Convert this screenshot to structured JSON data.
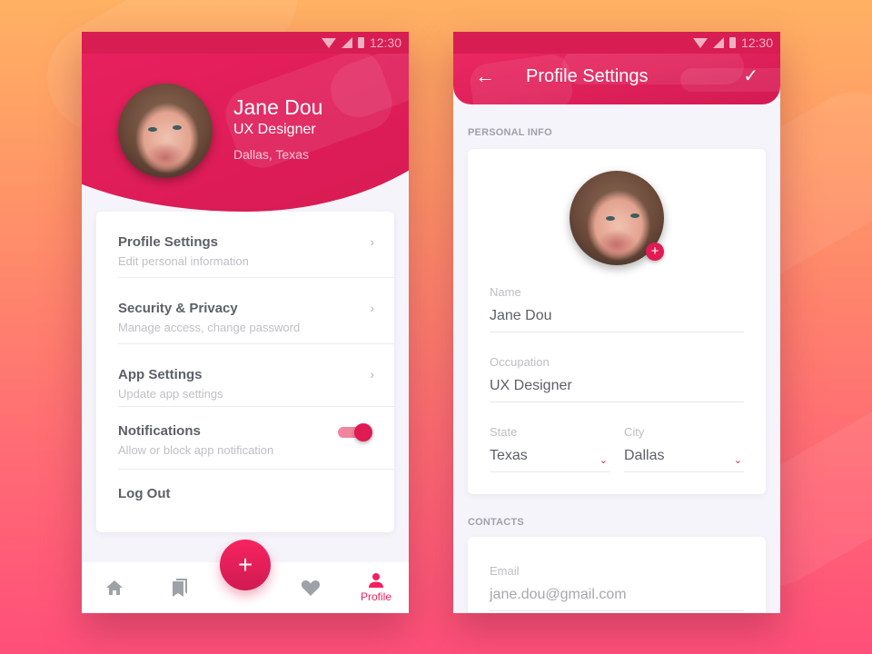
{
  "status_bar": {
    "time": "12:30"
  },
  "profile_screen": {
    "user": {
      "name": "Jane Dou",
      "role": "UX Designer",
      "location": "Dallas, Texas"
    },
    "menu": [
      {
        "title": "Profile Settings",
        "subtitle": "Edit personal information",
        "trailing": "chevron"
      },
      {
        "title": "Security & Privacy",
        "subtitle": "Manage access, change password",
        "trailing": "chevron"
      },
      {
        "title": "App Settings",
        "subtitle": "Update app settings",
        "trailing": "chevron"
      },
      {
        "title": "Notifications",
        "subtitle": "Allow or block app notification",
        "trailing": "toggle",
        "enabled": true
      },
      {
        "title": "Log Out"
      }
    ],
    "fab_label": "+",
    "bottom_nav": [
      {
        "icon": "home-icon"
      },
      {
        "icon": "bookmarks-icon"
      },
      {
        "icon": "heart-icon"
      },
      {
        "icon": "profile-icon",
        "label": "Profile",
        "active": true
      }
    ]
  },
  "settings_screen": {
    "title": "Profile Settings",
    "back_glyph": "←",
    "save_glyph": "✓",
    "personal_info": {
      "section_title": "PERSONAL INFO",
      "add_photo_glyph": "+",
      "name": {
        "label": "Name",
        "value": "Jane Dou"
      },
      "occupation": {
        "label": "Occupation",
        "value": "UX Designer"
      },
      "state": {
        "label": "State",
        "value": "Texas"
      },
      "city": {
        "label": "City",
        "value": "Dallas"
      }
    },
    "contacts": {
      "section_title": "CONTACTS",
      "email": {
        "label": "Email",
        "value": "jane.dou@gmail.com"
      }
    }
  },
  "colors": {
    "accent": "#e01a53",
    "accent_light": "#f3849d",
    "text": "#5d6068",
    "muted": "#bfc0c6"
  },
  "chevron_glyph": "›",
  "dropdown_glyph": "⌄"
}
